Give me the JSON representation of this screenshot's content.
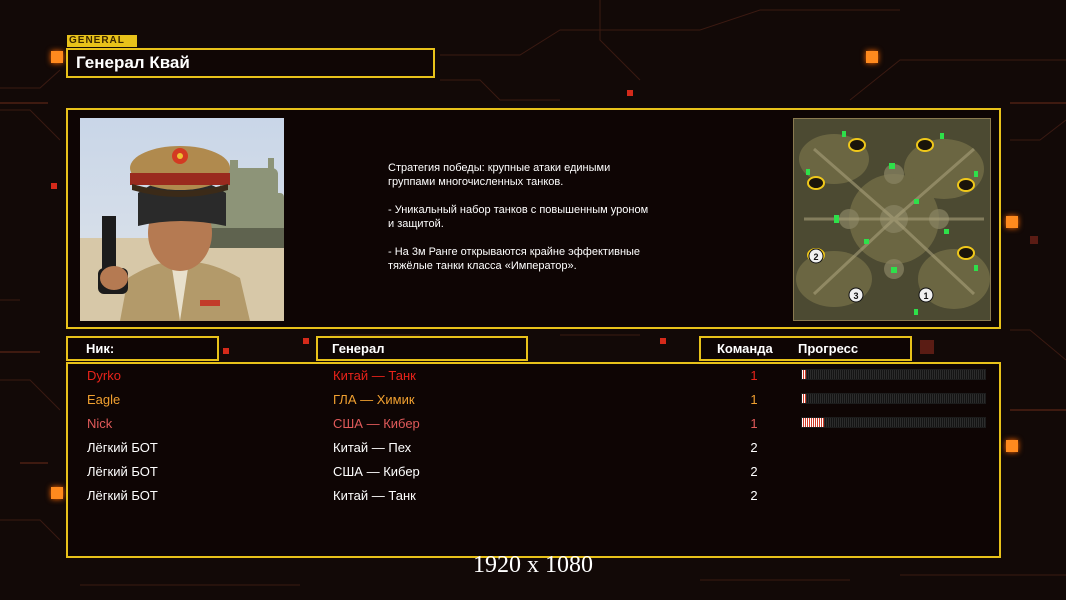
{
  "general_tag": "GENERAL",
  "general_name": "Генерал Квай",
  "strategy": [
    "Стратегия победы: крупные атаки едиными\n группами многочисленных танков.",
    "- Уникальный набор танков с повышенным уроном\n и защитой.",
    "- На 3м Ранге открываются крайне эффективные\n тяжёлые танки класса «Император»."
  ],
  "headers": {
    "nick": "Ник:",
    "general": "Генерал",
    "team": "Команда",
    "progress": "Прогресс"
  },
  "players": [
    {
      "nick": "Dyrko",
      "general": "Китай — Танк",
      "team": "1",
      "progress": 0.02,
      "color": "#e8231a",
      "has_progress": true
    },
    {
      "nick": "Eagle",
      "general": "ГЛА — Химик",
      "team": "1",
      "progress": 0.02,
      "color": "#f0a030",
      "has_progress": true
    },
    {
      "nick": "Nick",
      "general": "США — Кибер",
      "team": "1",
      "progress": 0.12,
      "color": "#e05a5a",
      "has_progress": true
    },
    {
      "nick": "Лёгкий БОТ",
      "general": "Китай — Пех",
      "team": "2",
      "color": "#ffffff",
      "has_progress": false
    },
    {
      "nick": "Лёгкий БОТ",
      "general": "США — Кибер",
      "team": "2",
      "color": "#ffffff",
      "has_progress": false
    },
    {
      "nick": "Лёгкий БОТ",
      "general": "Китай — Танк",
      "team": "2",
      "color": "#ffffff",
      "has_progress": false
    }
  ],
  "map_start_markers": [
    "1",
    "2",
    "3"
  ],
  "resolution_label": "1920 x 1080",
  "colors": {
    "accent": "#e8c21a",
    "background": "#120907",
    "deco_orange": "#ff8a1e"
  }
}
